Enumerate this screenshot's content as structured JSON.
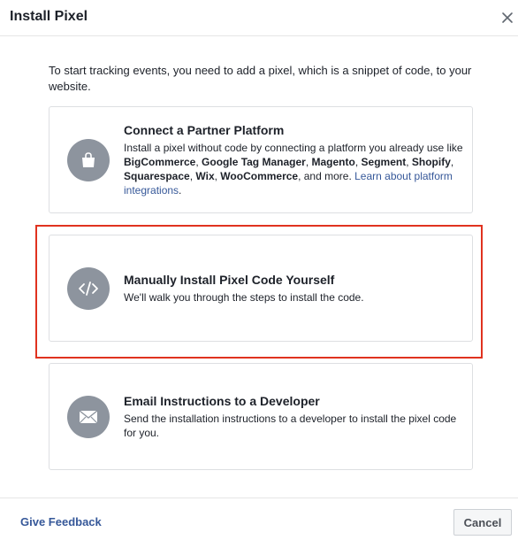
{
  "dialog": {
    "title": "Install Pixel",
    "close_icon": "close-icon"
  },
  "intro": {
    "text": "To start tracking events, you need to add a pixel, which is a snippet of code, to your website."
  },
  "options": [
    {
      "icon": "shopping-bag-icon",
      "title": "Connect a Partner Platform",
      "desc_prefix": "Install a pixel without code by connecting a platform you already use like ",
      "platforms": [
        "BigCommerce",
        "Google Tag Manager",
        "Magento",
        "Segment",
        "Shopify",
        "Squarespace",
        "Wix",
        "WooCommerce"
      ],
      "sep": ", ",
      "desc_suffix": ", and more. ",
      "link": "Learn about platform integrations",
      "link_end": "."
    },
    {
      "icon": "code-icon",
      "title": "Manually Install Pixel Code Yourself",
      "description": "We'll walk you through the steps to install the code."
    },
    {
      "icon": "envelope-icon",
      "title": "Email Instructions to a Developer",
      "description": "Send the installation instructions to a developer to install the pixel code for you."
    }
  ],
  "footer": {
    "feedback_label": "Give Feedback",
    "cancel_label": "Cancel"
  },
  "colors": {
    "highlight": "#e0321f",
    "link": "#365899",
    "icon_circle": "#8d949e"
  }
}
